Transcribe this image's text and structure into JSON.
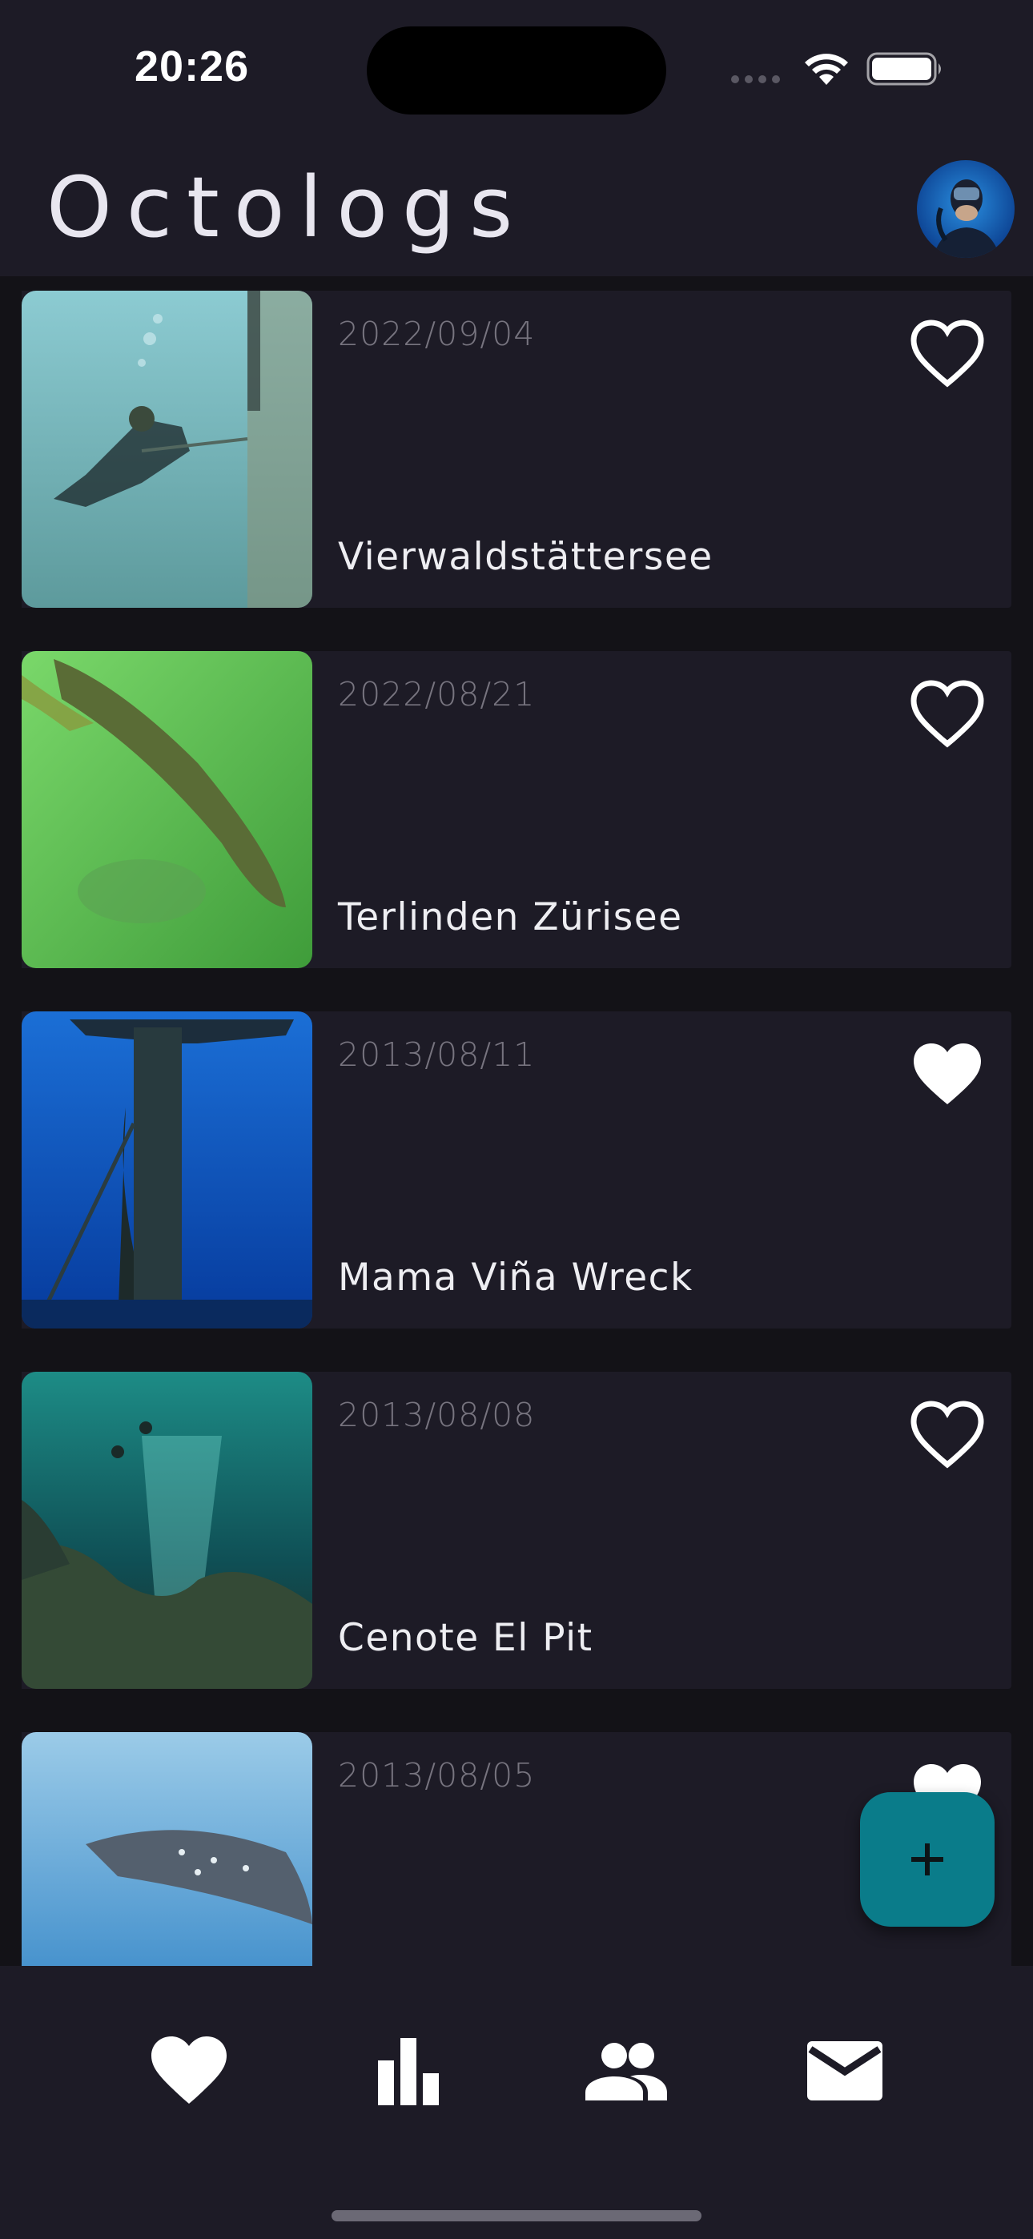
{
  "status_bar": {
    "time": "20:26"
  },
  "header": {
    "title": "Octologs"
  },
  "dives": [
    {
      "date": "2022/09/04",
      "name": "Vierwaldstättersee",
      "favorite": false
    },
    {
      "date": "2022/08/21",
      "name": "Terlinden Zürisee",
      "favorite": false
    },
    {
      "date": "2013/08/11",
      "name": "Mama Viña Wreck",
      "favorite": true
    },
    {
      "date": "2013/08/08",
      "name": "Cenote El Pit",
      "favorite": false
    },
    {
      "date": "2013/08/05",
      "name": "",
      "favorite": true
    }
  ],
  "icons": {
    "fab": "plus-icon",
    "nav": [
      "heart-icon",
      "bar-chart-icon",
      "people-icon",
      "mail-icon"
    ]
  },
  "colors": {
    "background": "#131217",
    "surface": "#1d1b26",
    "accent": "#0a7c8a",
    "date_text": "#77747f"
  }
}
